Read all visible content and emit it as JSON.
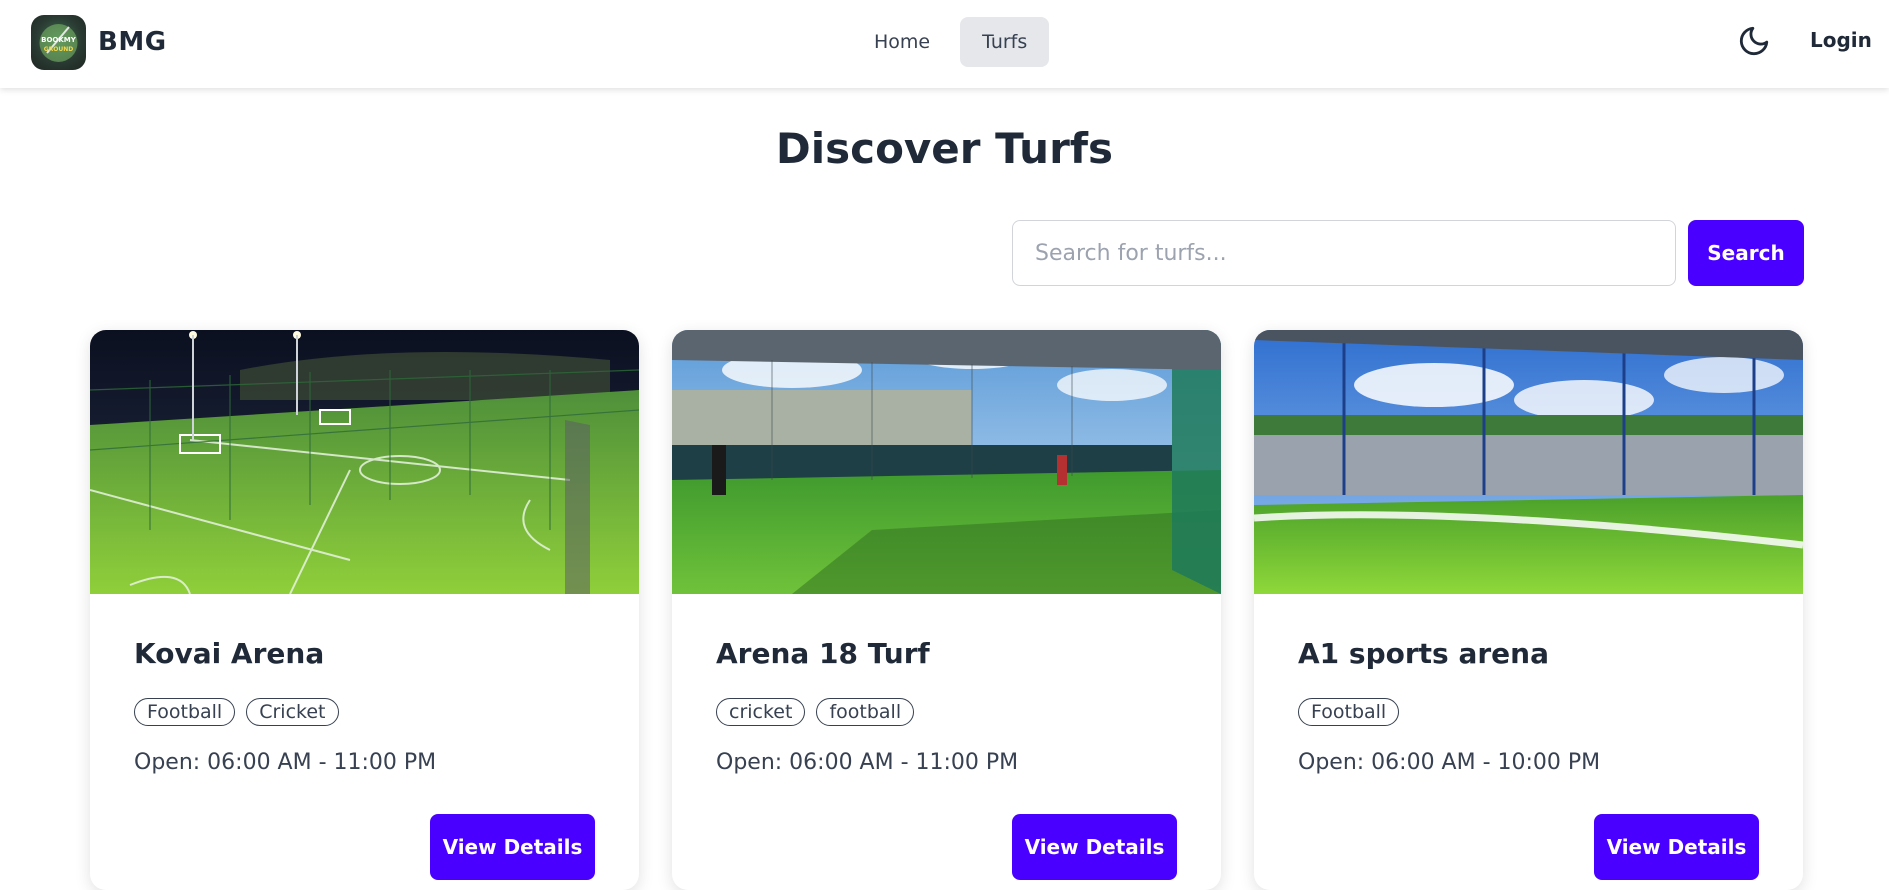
{
  "nav": {
    "brand": "BMG",
    "logo_text": "BOOKMY GROUND",
    "links": [
      {
        "label": "Home",
        "active": false
      },
      {
        "label": "Turfs",
        "active": true
      }
    ],
    "theme_icon": "moon-icon",
    "login_label": "Login"
  },
  "page": {
    "title": "Discover Turfs",
    "search_placeholder": "Search for turfs...",
    "search_value": "",
    "search_button": "Search"
  },
  "turfs": [
    {
      "name": "Kovai Arena",
      "tags": [
        "Football",
        "Cricket"
      ],
      "hours": "Open: 06:00 AM - 11:00 PM",
      "button": "View Details",
      "image": "night-lit-football-turf"
    },
    {
      "name": "Arena 18 Turf",
      "tags": [
        "cricket",
        "football"
      ],
      "hours": "Open: 06:00 AM - 11:00 PM",
      "button": "View Details",
      "image": "covered-turf-with-players"
    },
    {
      "name": "A1 sports arena",
      "tags": [
        "Football"
      ],
      "hours": "Open: 06:00 AM - 10:00 PM",
      "button": "View Details",
      "image": "turf-under-blue-sky"
    }
  ],
  "colors": {
    "accent": "#4a00ff",
    "text": "#1f2937",
    "nav_active_bg": "#e5e7eb"
  }
}
